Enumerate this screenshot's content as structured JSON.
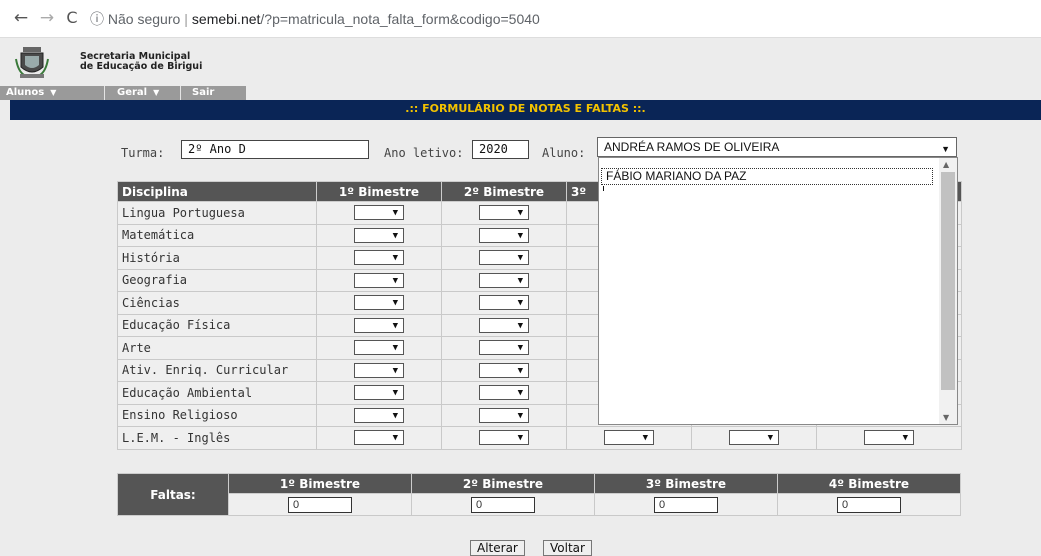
{
  "browser": {
    "back": "←",
    "forward": "→",
    "reload": "C",
    "security_icon": "ⓘ",
    "security_text": "Não seguro",
    "url_host": "semebi.net",
    "url_path": "/?p=matricula_nota_falta_form&codigo=5040"
  },
  "header": {
    "line1": "Secretaria Municipal",
    "line2": "de Educação de Birigui"
  },
  "menu": {
    "items": [
      {
        "label": "Alunos",
        "has_dropdown": true
      },
      {
        "label": "Geral",
        "has_dropdown": true
      },
      {
        "label": "Sair",
        "has_dropdown": false
      }
    ]
  },
  "form_title": ".:: FORMULÁRIO DE NOTAS E FALTAS ::.",
  "filters": {
    "turma_label": "Turma:",
    "turma_value": "2º Ano D",
    "ano_label": "Ano letivo:",
    "ano_value": "2020",
    "aluno_label": "Aluno:",
    "aluno_value": "ANDRÉA RAMOS DE OLIVEIRA"
  },
  "dropdown": {
    "option_highlighted": "FÁBIO MARIANO DA PAZ"
  },
  "grades": {
    "headers": [
      "Disciplina",
      "1º Bimestre",
      "2º Bimestre",
      "3º"
    ],
    "subjects": [
      "Lingua Portuguesa",
      "Matemática",
      "História",
      "Geografia",
      "Ciências",
      "Educação Física",
      "Arte",
      "Ativ. Enriq. Curricular",
      "Educação Ambiental",
      "Ensino Religioso",
      "L.E.M. - Inglês"
    ]
  },
  "faltas": {
    "label": "Faltas:",
    "headers": [
      "1º Bimestre",
      "2º Bimestre",
      "3º Bimestre",
      "4º Bimestre"
    ],
    "values": [
      "0",
      "0",
      "0",
      "0"
    ]
  },
  "buttons": {
    "alterar": "Alterar",
    "voltar": "Voltar"
  },
  "colors": {
    "title_bar_bg": "#0a2556",
    "title_text": "#f2c200",
    "header_cell_bg": "#555555",
    "menu_bg": "#9a9a9a"
  }
}
